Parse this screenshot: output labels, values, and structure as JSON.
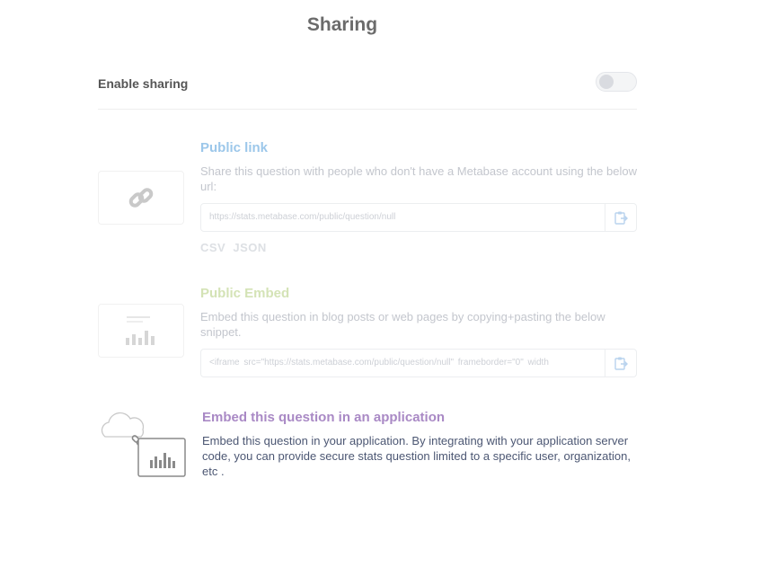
{
  "header": {
    "title": "Sharing"
  },
  "enable_sharing": {
    "label": "Enable sharing",
    "enabled": false
  },
  "public_link": {
    "title": "Public link",
    "description": "Share this question with people who don't have a Metabase account using the below url:",
    "url": "https://stats.metabase.com/public/question/null",
    "formats": [
      "CSV",
      "JSON"
    ],
    "icon": "link-icon",
    "color": "#9cc7ea"
  },
  "public_embed": {
    "title": "Public Embed",
    "description": "Embed this question in blog posts or web pages by copying+pasting the below snippet.",
    "snippet": "<iframe   src=\"https://stats.metabase.com/public/question/null\"   frameborder=\"0\"   width",
    "icon": "embed-chart-icon",
    "color": "#d4e3b6"
  },
  "app_embed": {
    "title": "Embed this question in an application",
    "description": "Embed this question in your application. By integrating with your application server code, you can provide secure stats question limited to a specific user, organization, etc .",
    "icon": "cloud-chart-icon",
    "color": "#a989c5"
  }
}
